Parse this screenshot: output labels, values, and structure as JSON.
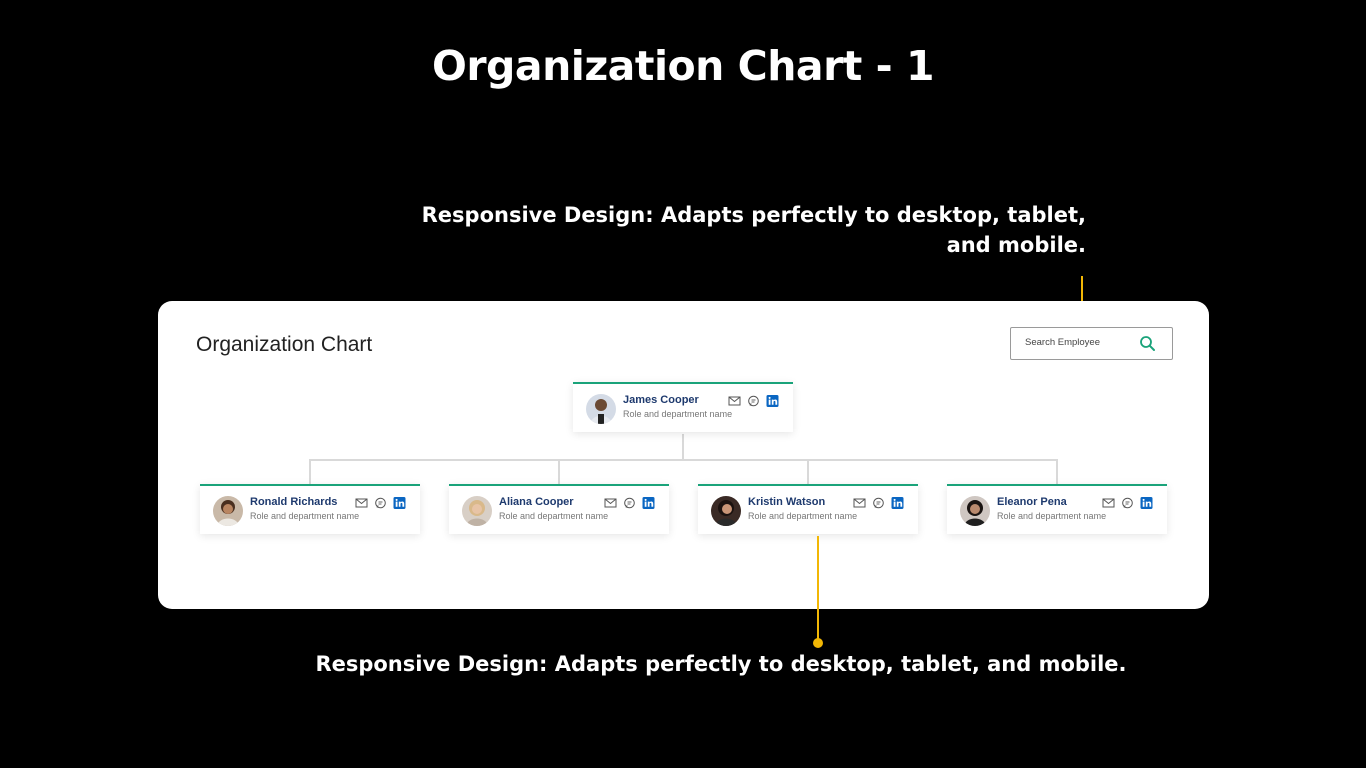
{
  "slide": {
    "title": "Organization Chart - 1",
    "callout_top": "Responsive Design: Adapts perfectly to desktop, tablet, and mobile.",
    "callout_bottom": "Responsive Design: Adapts perfectly to desktop, tablet, and mobile."
  },
  "colors": {
    "accent": "#1aa37a",
    "callout": "#f2b705",
    "name": "#1e3a6e",
    "linkedin": "#0a66c2"
  },
  "panel": {
    "title": "Organization Chart",
    "search": {
      "placeholder": "Search Employee",
      "icon": "search-icon"
    }
  },
  "root": {
    "name": "James Cooper",
    "role": "Role and department name",
    "icons": [
      "mail-icon",
      "chat-icon",
      "linkedin-icon"
    ]
  },
  "reports": [
    {
      "name": "Ronald Richards",
      "role": "Role and department name",
      "icons": [
        "mail-icon",
        "chat-icon",
        "linkedin-icon"
      ]
    },
    {
      "name": "Aliana Cooper",
      "role": "Role and department name",
      "icons": [
        "mail-icon",
        "chat-icon",
        "linkedin-icon"
      ]
    },
    {
      "name": "Kristin Watson",
      "role": "Role and department name",
      "icons": [
        "mail-icon",
        "chat-icon",
        "linkedin-icon"
      ]
    },
    {
      "name": "Eleanor Pena",
      "role": "Role and department name",
      "icons": [
        "mail-icon",
        "chat-icon",
        "linkedin-icon"
      ]
    }
  ]
}
